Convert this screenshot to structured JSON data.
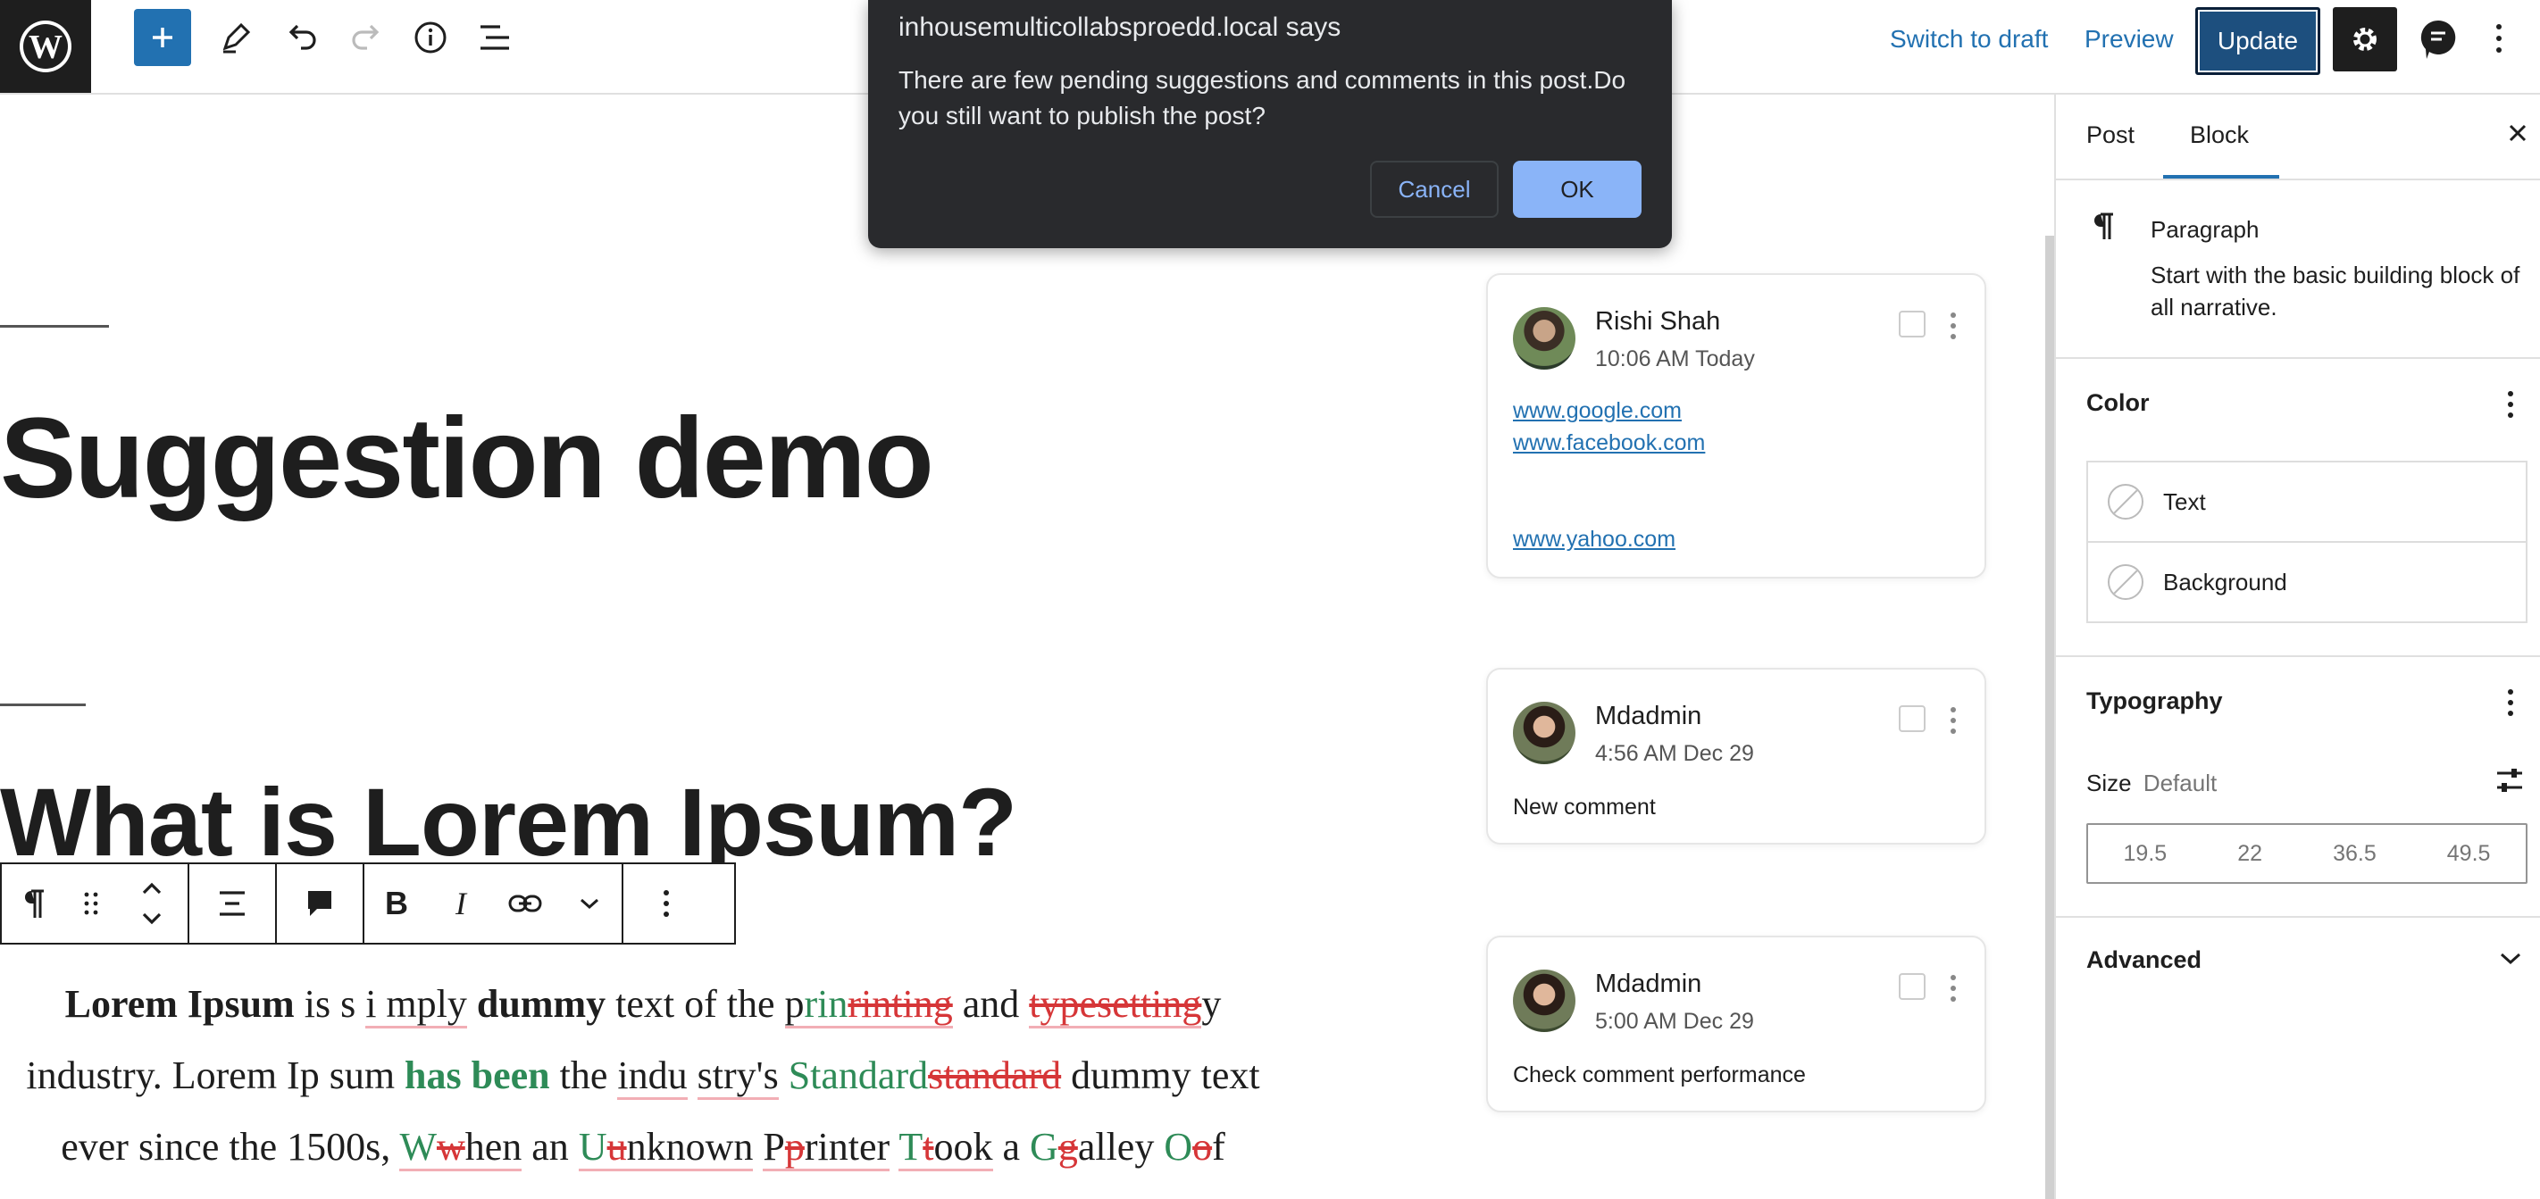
{
  "toolbar": {
    "switch_to_draft": "Switch to draft",
    "preview": "Preview",
    "update": "Update",
    "icons": [
      "wordpress-logo",
      "add-block",
      "edit-pencil",
      "undo",
      "redo",
      "info",
      "list-view",
      "settings-gear",
      "comments-bubble",
      "more-vertical"
    ]
  },
  "dialog": {
    "title": "inhousemulticollabsproedd.local says",
    "message": "There are few pending suggestions and comments in this post.Do you still want to publish the post?",
    "cancel": "Cancel",
    "ok": "OK"
  },
  "editor": {
    "title": "Suggestion demo",
    "heading": "What is Lorem Ipsum?",
    "paragraph": {
      "line1": [
        {
          "t": "Lorem Ipsum",
          "s": "strong"
        },
        {
          "t": " is s ",
          "s": ""
        },
        {
          "t": "i mply",
          "s": "ul"
        },
        {
          "t": " ",
          "s": ""
        },
        {
          "t": "dummy",
          "s": "strong"
        },
        {
          "t": " text of the ",
          "s": ""
        },
        {
          "t": "p",
          "s": "ul"
        },
        {
          "t": "rin",
          "s": "add ul"
        },
        {
          "t": "rinting",
          "s": "del ul"
        },
        {
          "t": " and ",
          "s": ""
        },
        {
          "t": "typesetting",
          "s": "del ul"
        },
        {
          "t": "y",
          "s": ""
        }
      ],
      "line2": [
        {
          "t": "industry. Lorem Ip sum ",
          "s": ""
        },
        {
          "t": "has been",
          "s": "add strong"
        },
        {
          "t": " the ",
          "s": ""
        },
        {
          "t": "indu",
          "s": "ul"
        },
        {
          "t": " ",
          "s": ""
        },
        {
          "t": "stry's",
          "s": "ul"
        },
        {
          "t": " ",
          "s": ""
        },
        {
          "t": "Standard",
          "s": "add"
        },
        {
          "t": "standard",
          "s": "del"
        },
        {
          "t": " dummy text",
          "s": ""
        }
      ],
      "line3": [
        {
          "t": "ever since the 1500s, ",
          "s": ""
        },
        {
          "t": "W",
          "s": "add ul"
        },
        {
          "t": "w",
          "s": "del ul"
        },
        {
          "t": "hen",
          "s": "ul"
        },
        {
          "t": " an ",
          "s": ""
        },
        {
          "t": "U",
          "s": "add ul"
        },
        {
          "t": "u",
          "s": "del ul"
        },
        {
          "t": "nknown",
          "s": "ul"
        },
        {
          "t": " ",
          "s": ""
        },
        {
          "t": "P",
          "s": "ul"
        },
        {
          "t": "p",
          "s": "del ul"
        },
        {
          "t": "rinter",
          "s": "ul"
        },
        {
          "t": " ",
          "s": ""
        },
        {
          "t": "T",
          "s": "add ul"
        },
        {
          "t": "t",
          "s": "del ul"
        },
        {
          "t": "ook",
          "s": "ul"
        },
        {
          "t": " a ",
          "s": ""
        },
        {
          "t": "G",
          "s": "add"
        },
        {
          "t": "g",
          "s": "del"
        },
        {
          "t": "alley ",
          "s": ""
        },
        {
          "t": "O",
          "s": "add"
        },
        {
          "t": "o",
          "s": "del"
        },
        {
          "t": "f",
          "s": ""
        }
      ]
    }
  },
  "block_toolbar": {
    "items": [
      "paragraph",
      "drag-handle",
      "move-up-down",
      "align",
      "comment",
      "bold",
      "italic",
      "link",
      "more-rich-text",
      "options"
    ],
    "bold": "B",
    "italic": "I"
  },
  "comments": [
    {
      "name": "Rishi Shah",
      "time": "10:06 AM Today",
      "links": [
        "www.google.com",
        "www.facebook.com",
        "www.yahoo.com"
      ]
    },
    {
      "name": "Mdadmin",
      "time": "4:56 AM Dec 29",
      "body": "New comment"
    },
    {
      "name": "Mdadmin",
      "time": "5:00 AM Dec 29",
      "body": "Check comment performance"
    }
  ],
  "sidebar": {
    "tabs": [
      "Post",
      "Block"
    ],
    "active_tab": "Block",
    "block_name": "Paragraph",
    "block_desc": "Start with the basic building block of all narrative.",
    "color_title": "Color",
    "color_items": [
      "Text",
      "Background"
    ],
    "typography_title": "Typography",
    "size_label": "Size",
    "size_value": "Default",
    "font_sizes": [
      "19.5",
      "22",
      "36.5",
      "49.5"
    ],
    "advanced": "Advanced"
  },
  "colors": {
    "accent": "#2271b1",
    "addition": "#2e8b57",
    "deletion": "#d63638",
    "dialog_bg": "#292a2d",
    "dialog_button": "#8ab4f8"
  }
}
